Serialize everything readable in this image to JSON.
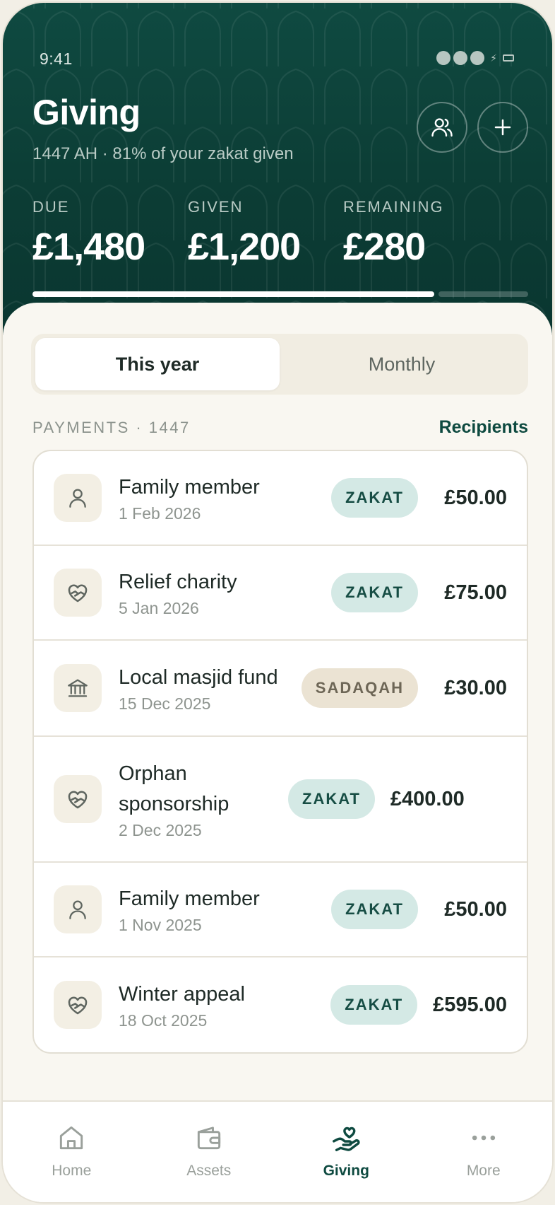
{
  "status": {
    "time": "9:41"
  },
  "header": {
    "title": "Giving",
    "subtitle": "1447 AH · 81% of your zakat given",
    "recipients_icon": "people-icon",
    "add_icon": "plus-icon",
    "stats": [
      {
        "label": "DUE",
        "value": "£1,480"
      },
      {
        "label": "GIVEN",
        "value": "£1,200"
      },
      {
        "label": "REMAINING",
        "value": "£280"
      }
    ],
    "progress_fraction": 0.81
  },
  "tabs": [
    {
      "label": "This year",
      "active": true
    },
    {
      "label": "Monthly",
      "active": false
    }
  ],
  "section": {
    "label": "PAYMENTS · 1447",
    "link": "Recipients"
  },
  "payments": [
    {
      "icon": "person-icon",
      "name": "Family member",
      "date": "1 Feb 2026",
      "type": "ZAKAT",
      "amount": "£50.00"
    },
    {
      "icon": "heart-hand-icon",
      "name": "Relief charity",
      "date": "5 Jan 2026",
      "type": "ZAKAT",
      "amount": "£75.00"
    },
    {
      "icon": "bank-icon",
      "name": "Local masjid fund",
      "date": "15 Dec 2025",
      "type": "SADAQAH",
      "amount": "£30.00"
    },
    {
      "icon": "heart-hand-icon",
      "name": "Orphan sponsorship",
      "date": "2 Dec 2025",
      "type": "ZAKAT",
      "amount": "£400.00"
    },
    {
      "icon": "person-icon",
      "name": "Family member",
      "date": "1 Nov 2025",
      "type": "ZAKAT",
      "amount": "£50.00"
    },
    {
      "icon": "heart-hand-icon",
      "name": "Winter appeal",
      "date": "18 Oct 2025",
      "type": "ZAKAT",
      "amount": "£595.00"
    }
  ],
  "nav": [
    {
      "label": "Home",
      "icon": "home-icon",
      "active": false
    },
    {
      "label": "Assets",
      "icon": "wallet-icon",
      "active": false
    },
    {
      "label": "Giving",
      "icon": "giving-hand-icon",
      "active": true
    },
    {
      "label": "More",
      "icon": "more-icon",
      "active": false
    }
  ],
  "colors": {
    "brand": "#0e4a40",
    "zakat_badge": "#d4e9e5",
    "sadaqah_badge": "#ebe3d3"
  }
}
